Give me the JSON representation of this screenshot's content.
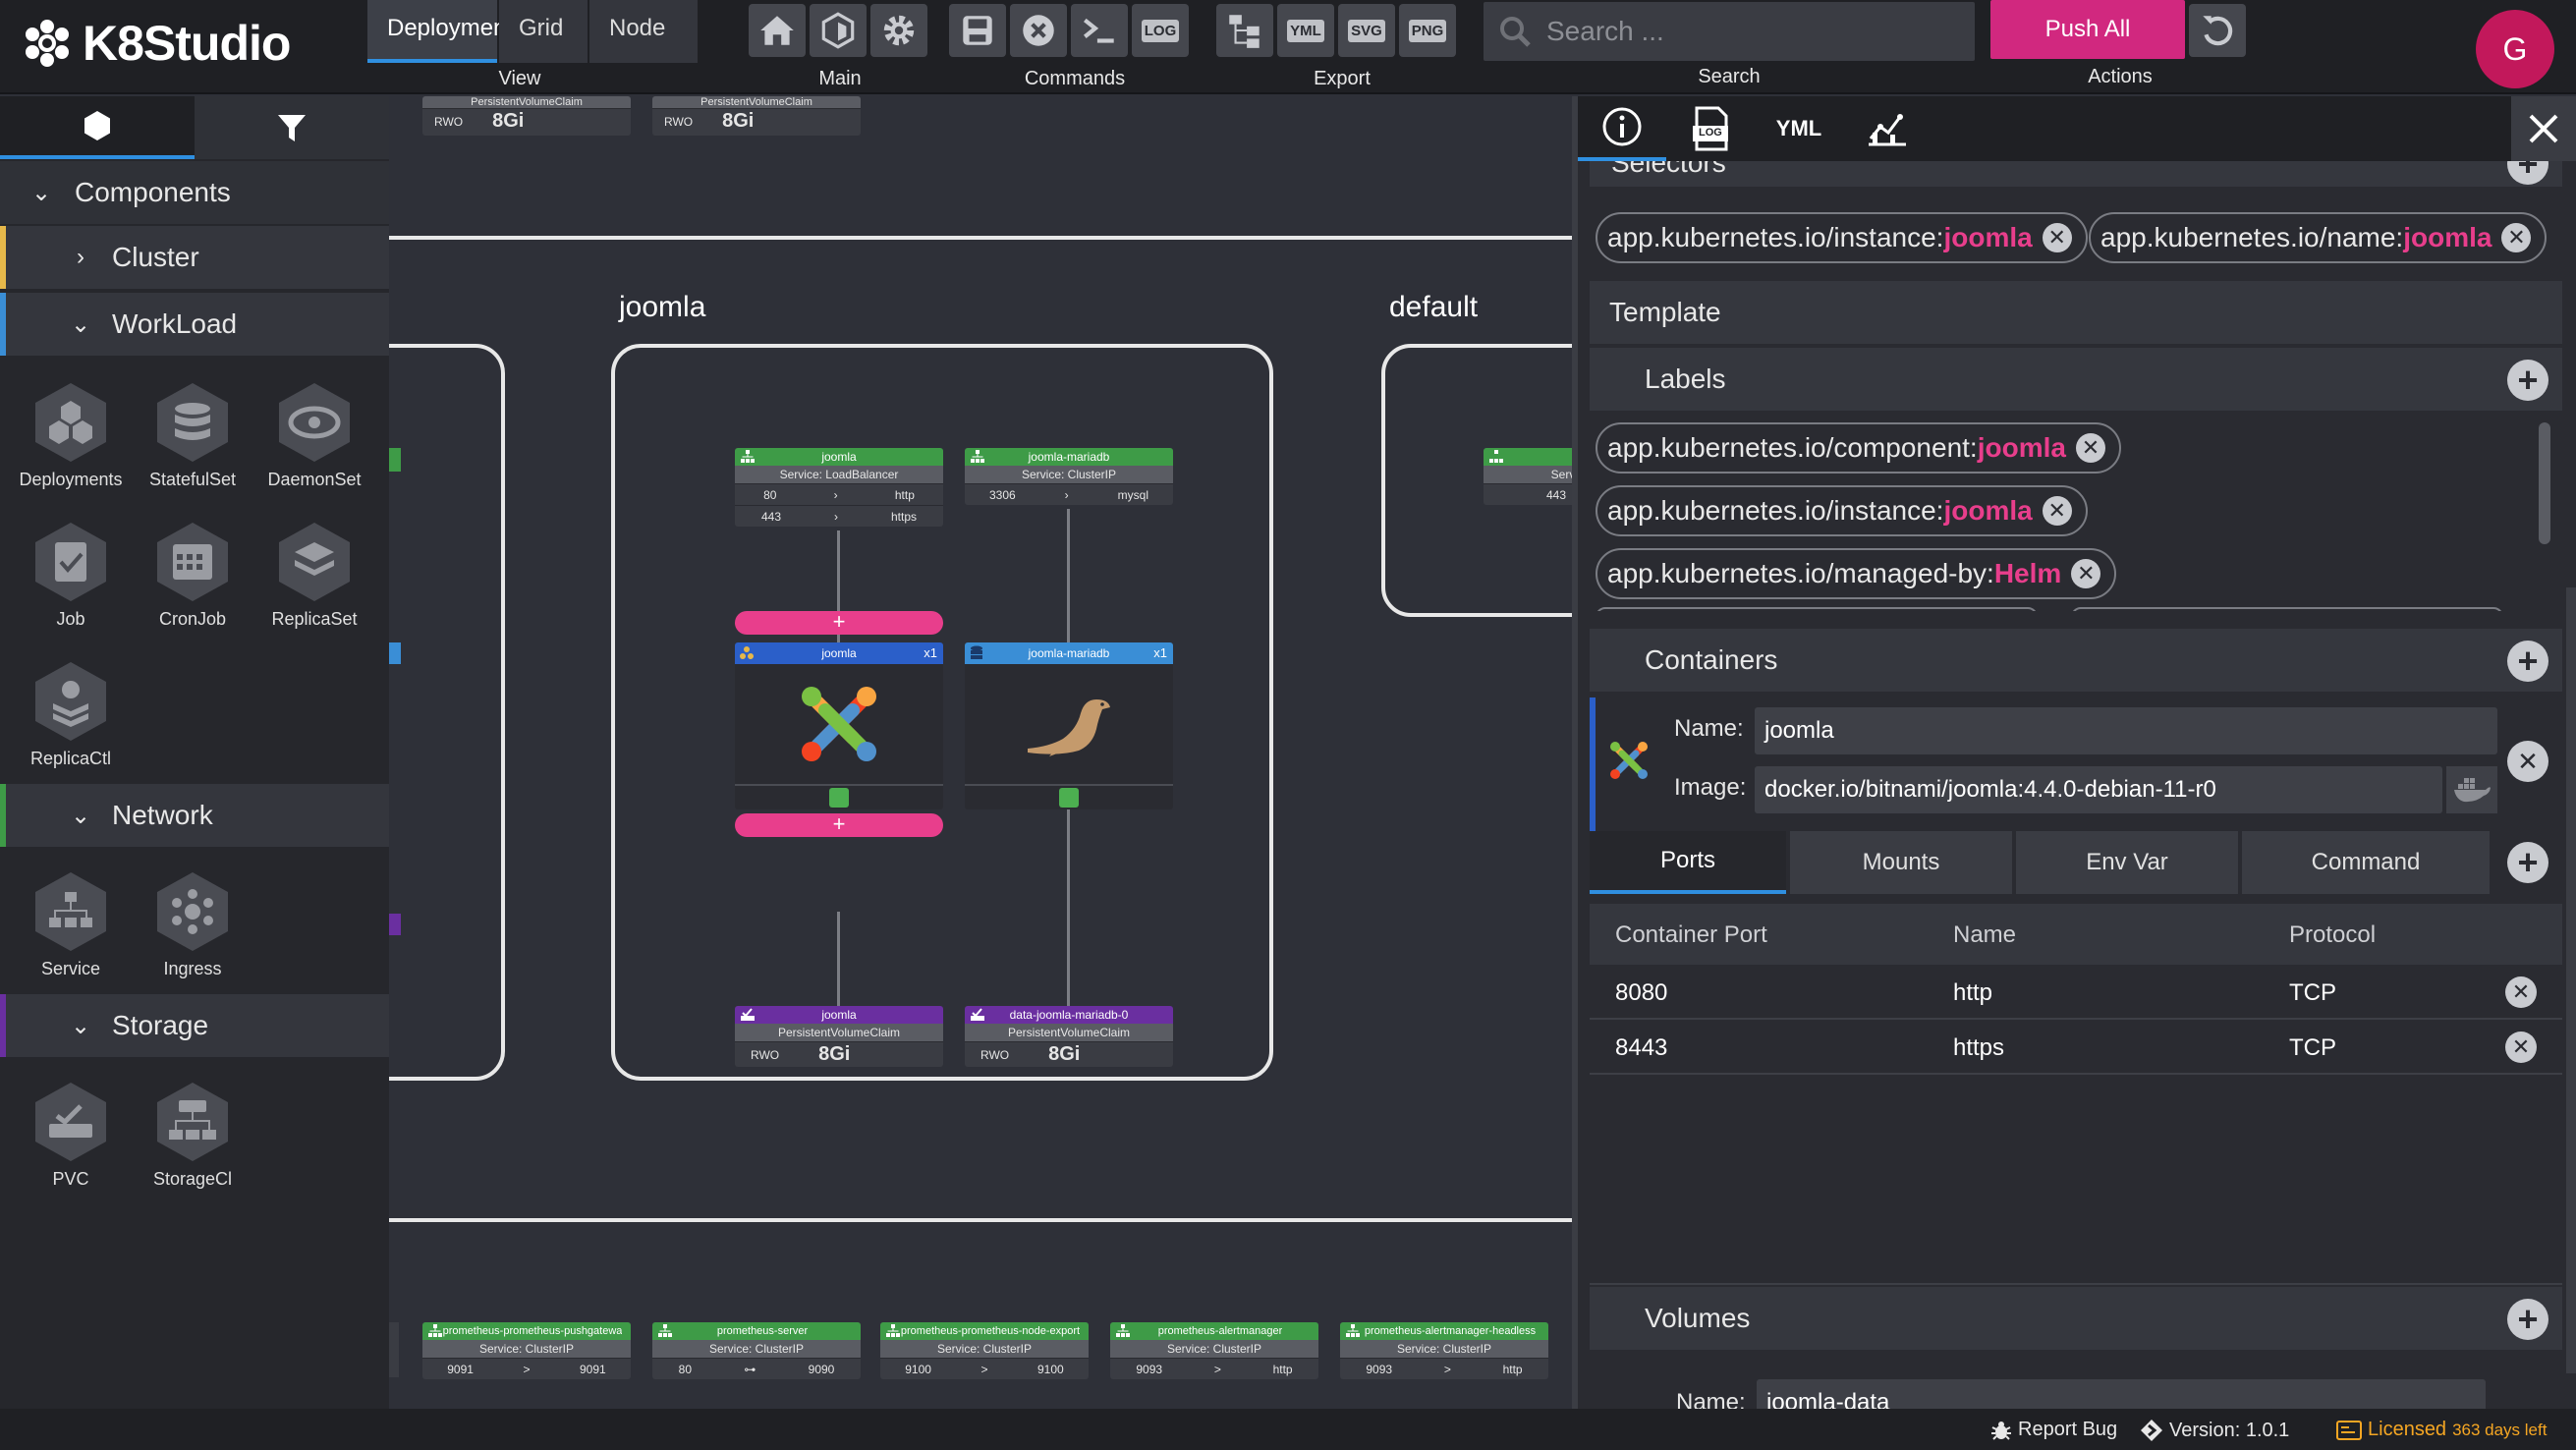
{
  "app": {
    "name": "K8Studio"
  },
  "toolbar": {
    "view_tabs": [
      "Deployment",
      "Grid",
      "Node"
    ],
    "groups": {
      "view": "View",
      "main": "Main",
      "commands": "Commands",
      "export": "Export",
      "search": "Search",
      "actions": "Actions"
    },
    "export_labels": {
      "log": "LOG",
      "yml": "YML",
      "svg": "SVG",
      "png": "PNG"
    },
    "search_placeholder": "Search ...",
    "push_label": "Push All",
    "avatar_letter": "G"
  },
  "sidebar": {
    "sections": {
      "components": "Components",
      "cluster": "Cluster",
      "workload": "WorkLoad",
      "network": "Network",
      "storage": "Storage"
    },
    "workload_items": [
      "Deployments",
      "StatefulSet",
      "DaemonSet",
      "Job",
      "CronJob",
      "ReplicaSet",
      "ReplicaCtl"
    ],
    "network_items": [
      "Service",
      "Ingress"
    ],
    "storage_items": [
      "PVC",
      "StorageCl"
    ]
  },
  "canvas": {
    "top_pvcs": [
      {
        "title": "PersistentVolumeClaim",
        "mode": "RWO",
        "size": "8Gi"
      },
      {
        "title": "PersistentVolumeClaim",
        "mode": "RWO",
        "size": "8Gi"
      }
    ],
    "namespaces": {
      "joomla": "joomla",
      "default": "default"
    },
    "services": {
      "joomla": {
        "name": "joomla",
        "type": "Service: LoadBalancer",
        "ports": [
          [
            "80",
            "http"
          ],
          [
            "443",
            "https"
          ]
        ]
      },
      "mariadb": {
        "name": "joomla-mariadb",
        "type": "Service: ClusterIP",
        "ports": [
          [
            "3306",
            "mysql"
          ]
        ]
      },
      "default_partial": {
        "type": "Servi",
        "port": "443"
      }
    },
    "workloads": {
      "joomla": {
        "name": "joomla",
        "replicas": "x1"
      },
      "mariadb": {
        "name": "joomla-mariadb",
        "replicas": "x1"
      }
    },
    "pvcs": {
      "joomla": {
        "name": "joomla",
        "title": "PersistentVolumeClaim",
        "mode": "RWO",
        "size": "8Gi"
      },
      "mariadb": {
        "name": "data-joomla-mariadb-0",
        "title": "PersistentVolumeClaim",
        "mode": "RWO",
        "size": "8Gi"
      }
    },
    "add_symbol": "+",
    "bottom_services": [
      {
        "name": "prometheus-prometheus-pushgatewa",
        "type": "Service: ClusterIP",
        "p1": "9091",
        "arrow": ">",
        "p2": "9091"
      },
      {
        "name": "prometheus-server",
        "type": "Service: ClusterIP",
        "p1": "80",
        "arrow": "⊶",
        "p2": "9090"
      },
      {
        "name": "prometheus-prometheus-node-export",
        "type": "Service: ClusterIP",
        "p1": "9100",
        "arrow": ">",
        "p2": "9100"
      },
      {
        "name": "prometheus-alertmanager",
        "type": "Service: ClusterIP",
        "p1": "9093",
        "arrow": ">",
        "p2": "http"
      },
      {
        "name": "prometheus-alertmanager-headless",
        "type": "Service: ClusterIP",
        "p1": "9093",
        "arrow": ">",
        "p2": "http"
      }
    ]
  },
  "panel": {
    "tab_yml": "YML",
    "tab_log": "LOG",
    "selectors_title": "Selectors",
    "selectors": [
      {
        "key": "app.kubernetes.io/instance:",
        "value": "joomla"
      },
      {
        "key": "app.kubernetes.io/name:",
        "value": "joomla"
      }
    ],
    "template_title": "Template",
    "labels_title": "Labels",
    "labels": [
      {
        "key": "app.kubernetes.io/component:",
        "value": "joomla"
      },
      {
        "key": "app.kubernetes.io/instance:",
        "value": "joomla"
      },
      {
        "key": "app.kubernetes.io/managed-by:",
        "value": "Helm"
      }
    ],
    "containers_title": "Containers",
    "container": {
      "name_label": "Name:",
      "name": "joomla",
      "image_label": "Image:",
      "image": "docker.io/bitnami/joomla:4.4.0-debian-11-r0"
    },
    "container_tabs": [
      "Ports",
      "Mounts",
      "Env Var",
      "Command"
    ],
    "ports_headers": [
      "Container Port",
      "Name",
      "Protocol"
    ],
    "ports": [
      {
        "port": "8080",
        "name": "http",
        "protocol": "TCP"
      },
      {
        "port": "8443",
        "name": "https",
        "protocol": "TCP"
      }
    ],
    "volumes_title": "Volumes",
    "volume": {
      "name_label": "Name:",
      "name": "joomla-data"
    }
  },
  "status": {
    "report": "Report Bug",
    "version": "Version: 1.0.1",
    "licensed": "Licensed",
    "days_left": "363 days left"
  },
  "colors": {
    "accent": "#2f8fe0",
    "push": "#d1287f",
    "highlight": "#e83e8c",
    "service": "#3e9b47",
    "workload_dep": "#2b5fc9",
    "workload_sts": "#3a8ed6",
    "pvc": "#6a2fa0"
  }
}
